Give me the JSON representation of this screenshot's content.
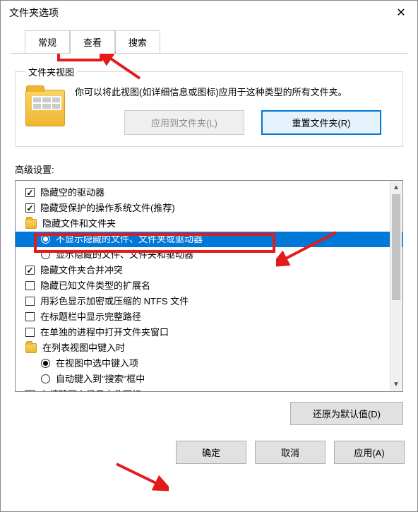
{
  "title": "文件夹选项",
  "tabs": {
    "general": "常规",
    "view": "查看",
    "search": "搜索"
  },
  "folder_view": {
    "legend": "文件夹视图",
    "description": "你可以将此视图(如详细信息或图标)应用于这种类型的所有文件夹。",
    "apply_btn": "应用到文件夹(L)",
    "reset_btn": "重置文件夹(R)"
  },
  "advanced_label": "高级设置:",
  "tree": {
    "hide_empty_drives": "隐藏空的驱动器",
    "hide_protected": "隐藏受保护的操作系统文件(推荐)",
    "hidden_files_group": "隐藏文件和文件夹",
    "dont_show_hidden": "不显示隐藏的文件、文件夹或驱动器",
    "show_hidden": "显示隐藏的文件、文件夹和驱动器",
    "merge_conflict": "隐藏文件夹合并冲突",
    "hide_ext": "隐藏已知文件类型的扩展名",
    "ntfs_color": "用彩色显示加密或压缩的 NTFS 文件",
    "full_path": "在标题栏中显示完整路径",
    "separate_process": "在单独的进程中打开文件夹窗口",
    "list_keyin_group": "在列表视图中键入时",
    "select_in_view": "在视图中选中键入项",
    "auto_search": "自动键入到\"搜索\"框中",
    "truncated_item": "在缩略图上显示文件图标"
  },
  "restore_defaults": "还原为默认值(D)",
  "footer": {
    "ok": "确定",
    "cancel": "取消",
    "apply": "应用(A)"
  }
}
